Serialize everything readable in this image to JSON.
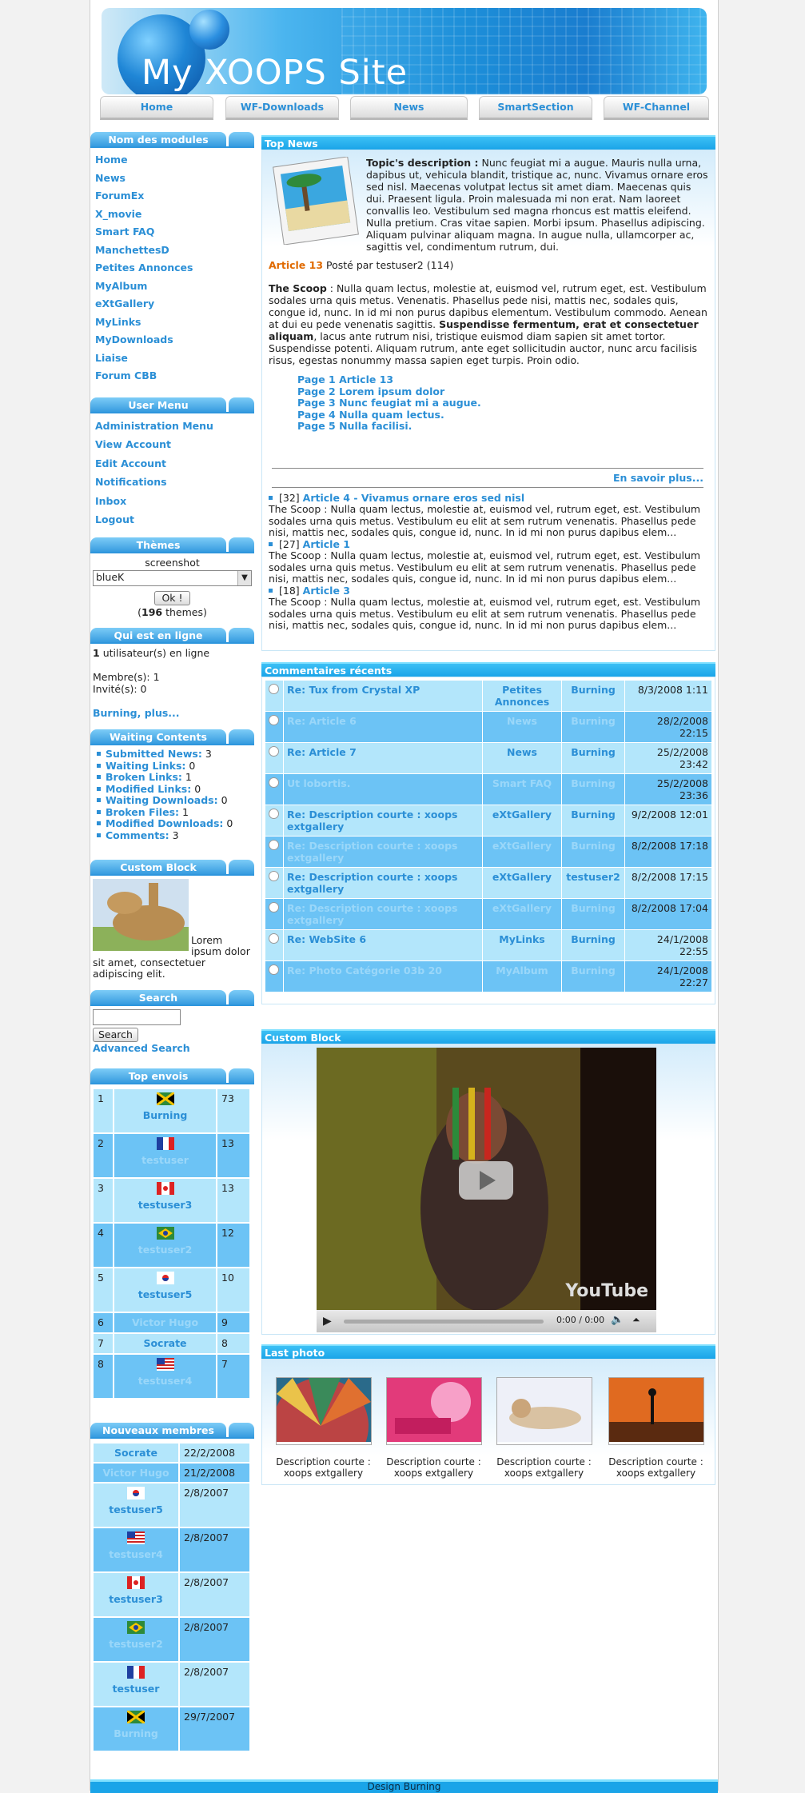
{
  "header": {
    "site_name": "My XOOPS Site",
    "nav": [
      "Home",
      "WF-Downloads",
      "News",
      "SmartSection",
      "WF-Channel"
    ]
  },
  "left": {
    "modules": {
      "title": "Nom des modules",
      "items": [
        "Home",
        "News",
        "ForumEx",
        "X_movie",
        "Smart FAQ",
        "ManchettesD",
        "Petites Annonces",
        "MyAlbum",
        "eXtGallery",
        "MyLinks",
        "MyDownloads",
        "Liaise",
        "Forum CBB"
      ]
    },
    "usermenu": {
      "title": "User Menu",
      "items": [
        "Administration Menu",
        "View Account",
        "Edit Account",
        "Notifications",
        "Inbox",
        "Logout"
      ]
    },
    "themes": {
      "title": "Thèmes",
      "screenshot": "screenshot",
      "selected": "blueK",
      "ok": "Ok !",
      "count": "196",
      "count_suffix": "themes)"
    },
    "online": {
      "title": "Qui est en ligne",
      "users_count": "1",
      "users_text": "utilisateur(s) en ligne",
      "members": "Membre(s): 1",
      "guests": "Invité(s): 0",
      "link": "Burning, plus..."
    },
    "waiting": {
      "title": "Waiting Contents",
      "items": [
        {
          "label": "Submitted News:",
          "value": "3"
        },
        {
          "label": "Waiting Links:",
          "value": "0"
        },
        {
          "label": "Broken Links:",
          "value": "1"
        },
        {
          "label": "Modified Links:",
          "value": "0"
        },
        {
          "label": "Waiting Downloads:",
          "value": "0"
        },
        {
          "label": "Broken Files:",
          "value": "1"
        },
        {
          "label": "Modified Downloads:",
          "value": "0"
        },
        {
          "label": "Comments:",
          "value": "3"
        }
      ]
    },
    "custom": {
      "title": "Custom Block",
      "text": "Lorem ipsum dolor sit amet, consectetuer adipiscing elit."
    },
    "search": {
      "title": "Search",
      "button": "Search",
      "advanced": "Advanced Search"
    },
    "topenvois": {
      "title": "Top envois",
      "rows": [
        {
          "rank": "1",
          "name": "Burning",
          "count": "73",
          "flag": "jamaica"
        },
        {
          "rank": "2",
          "name": "testuser",
          "count": "13",
          "flag": "france"
        },
        {
          "rank": "3",
          "name": "testuser3",
          "count": "13",
          "flag": "canada"
        },
        {
          "rank": "4",
          "name": "testuser2",
          "count": "12",
          "flag": "brazil"
        },
        {
          "rank": "5",
          "name": "testuser5",
          "count": "10",
          "flag": "korea"
        },
        {
          "rank": "6",
          "name": "Victor Hugo",
          "count": "9",
          "flag": ""
        },
        {
          "rank": "7",
          "name": "Socrate",
          "count": "8",
          "flag": ""
        },
        {
          "rank": "8",
          "name": "testuser4",
          "count": "7",
          "flag": "usa"
        }
      ]
    },
    "newmembers": {
      "title": "Nouveaux membres",
      "rows": [
        {
          "name": "Socrate",
          "date": "22/2/2008",
          "flag": ""
        },
        {
          "name": "Victor Hugo",
          "date": "21/2/2008",
          "flag": ""
        },
        {
          "name": "testuser5",
          "date": "2/8/2007",
          "flag": "korea"
        },
        {
          "name": "testuser4",
          "date": "2/8/2007",
          "flag": "usa"
        },
        {
          "name": "testuser3",
          "date": "2/8/2007",
          "flag": "canada"
        },
        {
          "name": "testuser2",
          "date": "2/8/2007",
          "flag": "brazil"
        },
        {
          "name": "testuser",
          "date": "2/8/2007",
          "flag": "france"
        },
        {
          "name": "Burning",
          "date": "29/7/2007",
          "flag": "jamaica"
        }
      ]
    }
  },
  "topnews": {
    "title": "Top News",
    "topic_label": "Topic's description :",
    "topic_text": "Nunc feugiat mi a augue. Mauris nulla urna, dapibus ut, vehicula blandit, tristique ac, nunc. Vivamus ornare eros sed nisl. Maecenas volutpat lectus sit amet diam. Maecenas quis dui. Praesent ligula. Proin malesuada mi non erat. Nam laoreet convallis leo. Vestibulum sed magna rhoncus est mattis eleifend. Nulla pretium. Cras vitae sapien. Morbi ipsum. Phasellus adipiscing. Aliquam pulvinar aliquam magna. In augue nulla, ullamcorper ac, sagittis vel, condimentum rutrum, dui.",
    "article_title": "Article 13",
    "posted_by": "Posté par testuser2 (114)",
    "scoop_label": "The Scoop",
    "scoop_text1": " : Nulla quam lectus, molestie at, euismod vel, rutrum eget, est. Vestibulum sodales urna quis metus. Venenatis. Phasellus pede nisi, mattis nec, sodales quis, congue id, nunc. In id mi non purus dapibus elementum. Vestibulum commodo. Aenean at dui eu pede venenatis sagittis. ",
    "scoop_bold": "Suspendisse fermentum, erat et consectetuer aliquam",
    "scoop_text2": ", lacus ante rutrum nisi, tristique euismod diam sapien sit amet tortor. Suspendisse potenti. Aliquam rutrum, ante eget sollicitudin auctor, nunc arcu facilisis risus, egestas nonummy massa sapien eget turpis. Proin odio.",
    "pages": [
      "Page 1 Article 13",
      "Page 2 Lorem ipsum dolor",
      "Page 3 Nunc feugiat mi a augue.",
      "Page 4 Nulla quam lectus.",
      "Page 5 Nulla facilisi."
    ],
    "read_more": "En savoir plus...",
    "others": [
      {
        "count": "[32]",
        "title": "Article 4 - Vivamus ornare eros sed nisl",
        "text": "The Scoop : Nulla quam lectus, molestie at, euismod vel, rutrum eget, est. Vestibulum sodales urna quis metus. Vestibulum eu elit at sem rutrum venenatis. Phasellus pede nisi, mattis nec, sodales quis, congue id, nunc. In id mi non purus dapibus elem..."
      },
      {
        "count": "[27]",
        "title": "Article 1",
        "text": "The Scoop : Nulla quam lectus, molestie at, euismod vel, rutrum eget, est. Vestibulum sodales urna quis metus. Vestibulum eu elit at sem rutrum venenatis. Phasellus pede nisi, mattis nec, sodales quis, congue id, nunc. In id mi non purus dapibus elem..."
      },
      {
        "count": "[18]",
        "title": "Article 3",
        "text": "The Scoop : Nulla quam lectus, molestie at, euismod vel, rutrum eget, est. Vestibulum sodales urna quis metus. Vestibulum eu elit at sem rutrum venenatis. Phasellus pede nisi, mattis nec, sodales quis, congue id, nunc. In id mi non purus dapibus elem..."
      }
    ]
  },
  "comments": {
    "title": "Commentaires récents",
    "rows": [
      {
        "subject": "Re: Tux from Crystal XP",
        "module": "Petites Annonces",
        "user": "Burning",
        "date": "8/3/2008 1:11"
      },
      {
        "subject": "Re: Article 6",
        "module": "News",
        "user": "Burning",
        "date": "28/2/2008 22:15"
      },
      {
        "subject": "Re: Article 7",
        "module": "News",
        "user": "Burning",
        "date": "25/2/2008 23:42"
      },
      {
        "subject": "Ut lobortis.",
        "module": "Smart FAQ",
        "user": "Burning",
        "date": "25/2/2008 23:36"
      },
      {
        "subject": "Re: Description courte : xoops extgallery",
        "module": "eXtGallery",
        "user": "Burning",
        "date": "9/2/2008 12:01"
      },
      {
        "subject": "Re: Description courte : xoops extgallery",
        "module": "eXtGallery",
        "user": "Burning",
        "date": "8/2/2008 17:18"
      },
      {
        "subject": "Re: Description courte : xoops extgallery",
        "module": "eXtGallery",
        "user": "testuser2",
        "date": "8/2/2008 17:15"
      },
      {
        "subject": "Re: Description courte : xoops extgallery",
        "module": "eXtGallery",
        "user": "Burning",
        "date": "8/2/2008 17:04"
      },
      {
        "subject": "Re: WebSite 6",
        "module": "MyLinks",
        "user": "Burning",
        "date": "24/1/2008 22:55"
      },
      {
        "subject": "Re: Photo Catégorie 03b 20",
        "module": "MyAlbum",
        "user": "Burning",
        "date": "24/1/2008 22:27"
      }
    ]
  },
  "customblock": {
    "title": "Custom Block",
    "video_time": "0:00 / 0:00",
    "video_brand": "YouTube"
  },
  "lastphoto": {
    "title": "Last photo",
    "items": [
      {
        "caption": "Description courte : xoops extgallery"
      },
      {
        "caption": "Description courte : xoops extgallery"
      },
      {
        "caption": "Description courte : xoops extgallery"
      },
      {
        "caption": "Description courte : xoops extgallery"
      }
    ]
  },
  "footer": {
    "text": "Design Burning"
  },
  "colors": {
    "accent": "#2b8fd6",
    "header_blue": "#1aa4e8",
    "row_light": "#b3e6fb",
    "row_dark": "#6cc3f5",
    "article_orange": "#e06a00"
  }
}
